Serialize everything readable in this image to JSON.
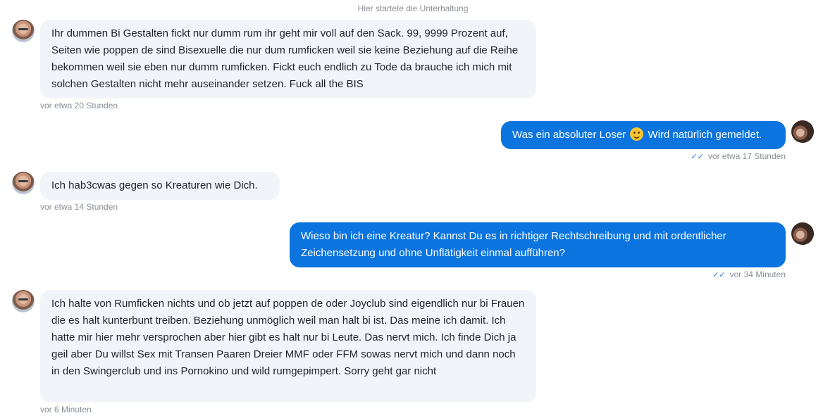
{
  "conversation_start": "Hier startete die Unterhaltung",
  "messages": [
    {
      "direction": "incoming",
      "text": "Ihr dummen Bi Gestalten fickt nur dumm rum ihr geht mir voll auf den Sack. 99, 9999 Prozent auf, Seiten wie poppen de sind Bisexuelle die nur dum rumficken weil sie keine Beziehung auf die Reihe bekommen weil sie eben nur dumm rumficken. Fickt euch endlich zu Tode da brauche ich mich mit solchen Gestalten nicht mehr auseinander setzen. Fuck all the BIS",
      "time": "vor etwa 20 Stunden"
    },
    {
      "direction": "outgoing",
      "text_before_emoji": "Was ein absoluter Loser",
      "emoji": "winking-face-emoji",
      "text_after_emoji": "Wird natürlich gemeldet.",
      "time": "vor etwa 17 Stunden",
      "read_status": "read"
    },
    {
      "direction": "incoming",
      "text": "Ich hab3cwas gegen so Kreaturen wie Dich.",
      "time": "vor etwa 14 Stunden"
    },
    {
      "direction": "outgoing",
      "text": "Wieso bin ich eine Kreatur? Kannst Du es in richtiger Rechtschreibung und mit ordentlicher Zeichensetzung und ohne Unflätigkeit einmal aufführen?",
      "time": "vor 34 Minuten",
      "read_status": "read"
    },
    {
      "direction": "incoming",
      "text": "Ich halte von Rumficken nichts und ob jetzt auf poppen de oder Joyclub sind eigendlich nur bi Frauen die es halt kunterbunt treiben. Beziehung unmöglich weil man halt bi ist. Das meine ich damit. Ich hatte mir hier mehr versprochen aber hier gibt es halt nur bi Leute. Das nervt mich. Ich finde Dich ja geil aber Du willst Sex mit Transen Paaren Dreier MMF oder FFM sowas nervt mich und dann noch in den Swingerclub und ins Pornokino und wild rumgepimpert. Sorry geht gar nicht",
      "time": "vor 6 Minuten"
    }
  ],
  "colors": {
    "incoming_bubble": "#f1f5f9",
    "outgoing_bubble": "#0b74de",
    "meta_text": "#8a8f96",
    "read_check": "#2f7fd6"
  },
  "icons": {
    "read_receipt": "double-check-icon",
    "incoming_avatar": "avatar-photo-male",
    "outgoing_avatar": "avatar-photo-female"
  }
}
